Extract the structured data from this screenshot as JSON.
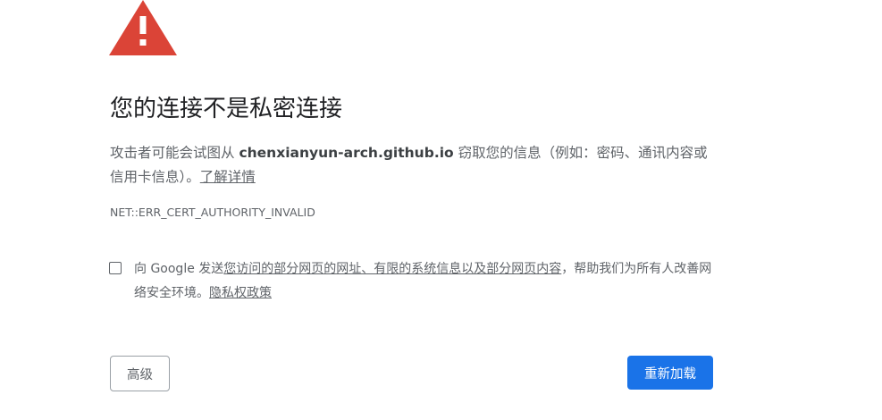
{
  "icon": {
    "name": "warning-triangle-icon",
    "color": "#db4437"
  },
  "title": "您的连接不是私密连接",
  "description": {
    "prefix": "攻击者可能会试图从 ",
    "host": "chenxianyun-arch.github.io",
    "suffix": " 窃取您的信息（例如：密码、通讯内容或信用卡信息）。",
    "learn_more": "了解详情"
  },
  "error_code": "NET::ERR_CERT_AUTHORITY_INVALID",
  "optin": {
    "checked": false,
    "prefix": "向 Google 发送",
    "link_data": "您访问的部分网页的网址、有限的系统信息以及部分网页内容",
    "middle": "，帮助我们为所有人改善网络安全环境。",
    "privacy_link": "隐私权政策"
  },
  "buttons": {
    "advanced": "高级",
    "reload": "重新加载"
  },
  "colors": {
    "primary": "#1a73e8",
    "text": "#5f6368",
    "title": "#202124"
  }
}
